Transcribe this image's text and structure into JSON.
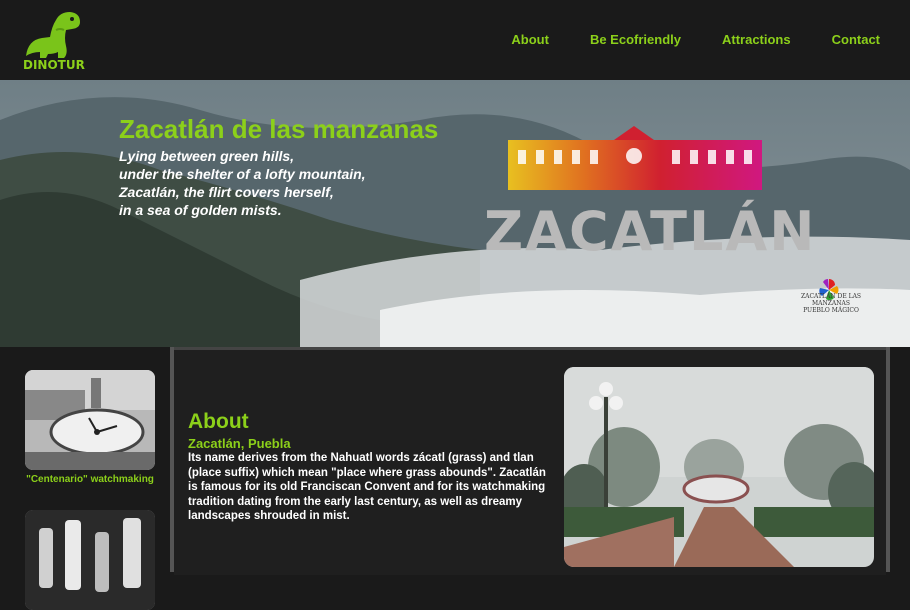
{
  "brand": {
    "name": "DINOTUR"
  },
  "nav": [
    {
      "label": "About"
    },
    {
      "label": "Be Ecofriendly"
    },
    {
      "label": "Attractions"
    },
    {
      "label": "Contact"
    }
  ],
  "hero": {
    "title": "Zacatlán de las manzanas",
    "poem": [
      "Lying between green hills,",
      "under the shelter of a lofty mountain,",
      "Zacatlán, the flirt covers herself,",
      "in a sea of golden mists."
    ],
    "logo_word": "ZACATLÁN",
    "pueblo_magico": "ZACATLÁN DE LAS MANZANAS PUEBLO MÁGICO"
  },
  "sidebar": {
    "items": [
      {
        "caption": "\"Centenario\" watchmaking"
      },
      {
        "caption": ""
      }
    ]
  },
  "about": {
    "title": "About",
    "subtitle": "Zacatlán, Puebla",
    "body": "Its name derives from the Nahuatl words zácatl (grass) and tlan (place suffix) which mean \"place where grass abounds\". Zacatlán is famous for its old Franciscan Convent and for its watchmaking tradition dating from the early last century, as well as dreamy landscapes shrouded in mist."
  },
  "colors": {
    "accent": "#8cd01a",
    "background": "#1a1a1a"
  }
}
